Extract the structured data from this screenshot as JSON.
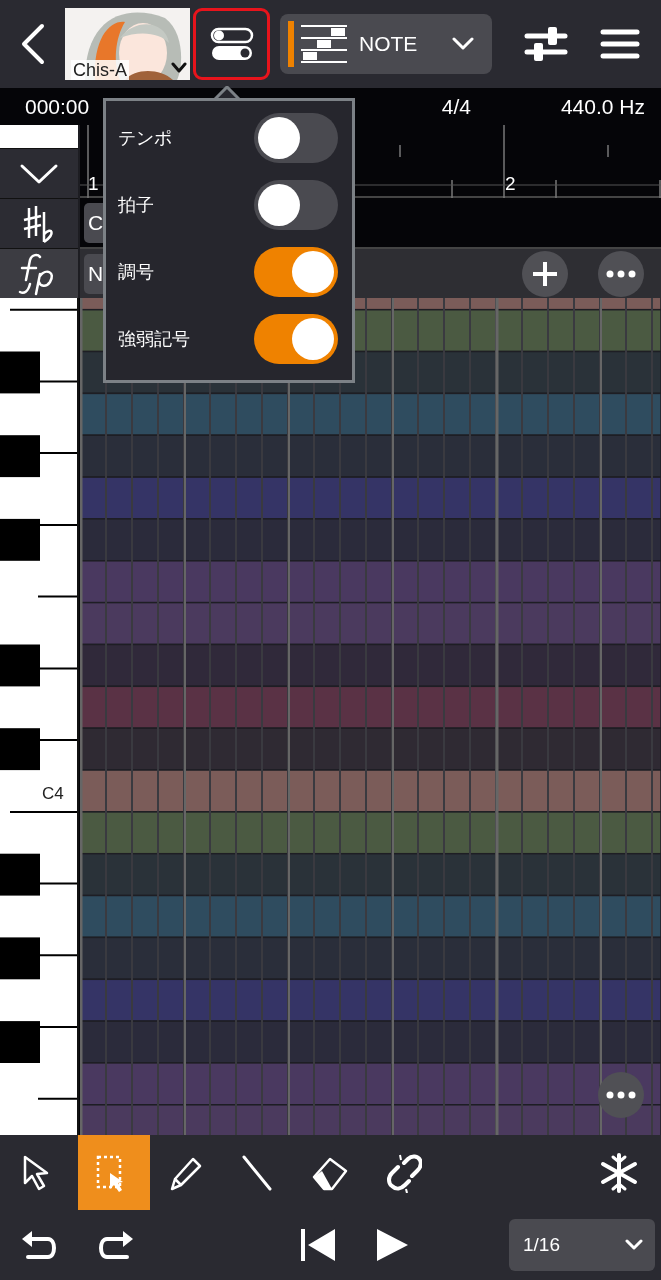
{
  "header": {
    "singer_name": "Chis-A",
    "track_label": "NOTE"
  },
  "info_bar": {
    "time": "000:00",
    "time_signature": "4/4",
    "pitch": "440.0 Hz"
  },
  "ruler": {
    "measures": [
      "1",
      "2"
    ]
  },
  "track_rows": [
    {
      "kind": "key",
      "label": "C"
    },
    {
      "kind": "dynamics",
      "label": "N"
    }
  ],
  "keyboard": {
    "octave_label": "C4"
  },
  "popup": {
    "items": [
      {
        "label": "テンポ",
        "on": false
      },
      {
        "label": "拍子",
        "on": false
      },
      {
        "label": "調号",
        "on": true
      },
      {
        "label": "強弱記号",
        "on": true
      }
    ]
  },
  "tools": [
    {
      "kind": "pointer",
      "selected": false
    },
    {
      "kind": "range-select",
      "selected": true
    },
    {
      "kind": "pencil",
      "selected": false
    },
    {
      "kind": "line",
      "selected": false
    },
    {
      "kind": "eraser",
      "selected": false
    },
    {
      "kind": "unlink",
      "selected": false
    }
  ],
  "quantize": {
    "value": "1/16"
  }
}
